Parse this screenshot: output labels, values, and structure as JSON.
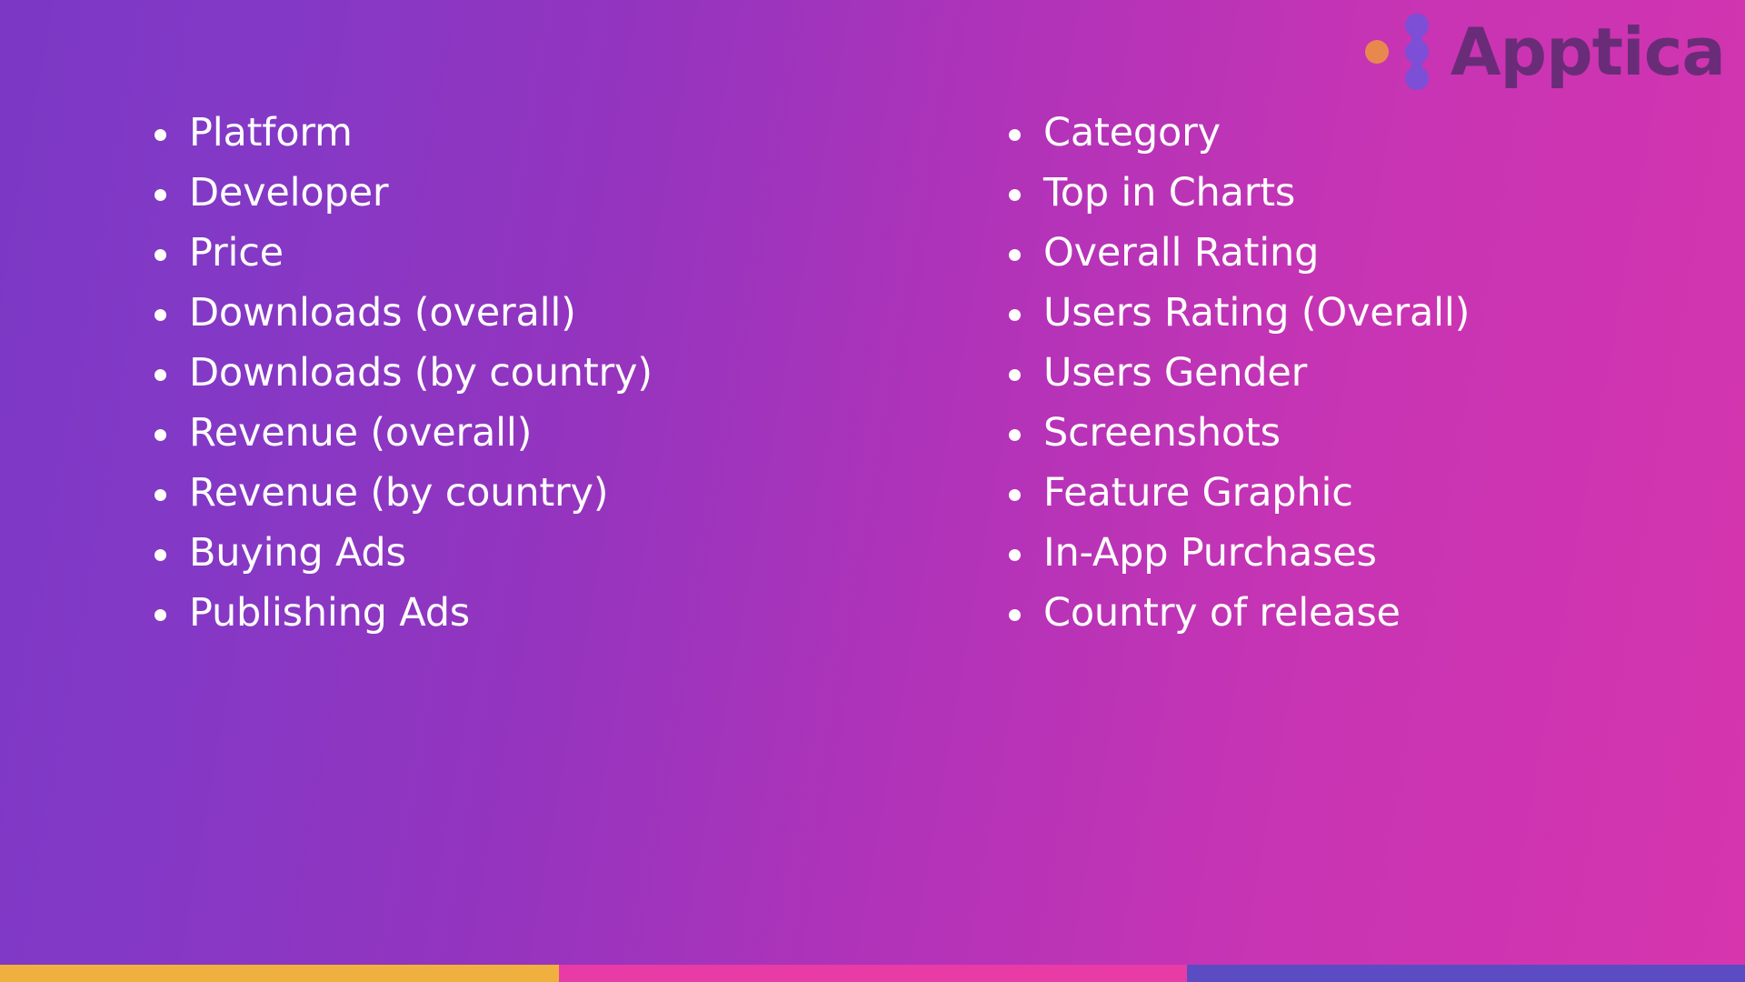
{
  "brand": {
    "name": "Apptica",
    "wordmark_color": "#6A2C78",
    "accent_dot_color": "#E8884E",
    "chain_color": "#7C4FD6"
  },
  "background": {
    "gradient_start": "#7B38C4",
    "gradient_end": "#D635AE"
  },
  "columns": {
    "left": {
      "items": [
        {
          "label": "Platform"
        },
        {
          "label": "Developer"
        },
        {
          "label": "Price"
        },
        {
          "label": "Downloads (overall)"
        },
        {
          "label": "Downloads (by country)"
        },
        {
          "label": "Revenue (overall)"
        },
        {
          "label": "Revenue (by country)"
        },
        {
          "label": "Buying Ads"
        },
        {
          "label": "Publishing Ads"
        }
      ]
    },
    "right": {
      "items": [
        {
          "label": "Category"
        },
        {
          "label": "Top in Charts"
        },
        {
          "label": "Overall Rating"
        },
        {
          "label": "Users Rating (Overall)"
        },
        {
          "label": "Users Gender"
        },
        {
          "label": "Screenshots"
        },
        {
          "label": "Feature Graphic"
        },
        {
          "label": "In-App Purchases"
        },
        {
          "label": "Country of release"
        }
      ]
    }
  },
  "bottom_bar": {
    "segments": [
      {
        "name": "yellow",
        "color": "#F0B03F"
      },
      {
        "name": "pink",
        "color": "#E93BA5"
      },
      {
        "name": "blue",
        "color": "#5B4CC4"
      }
    ]
  }
}
